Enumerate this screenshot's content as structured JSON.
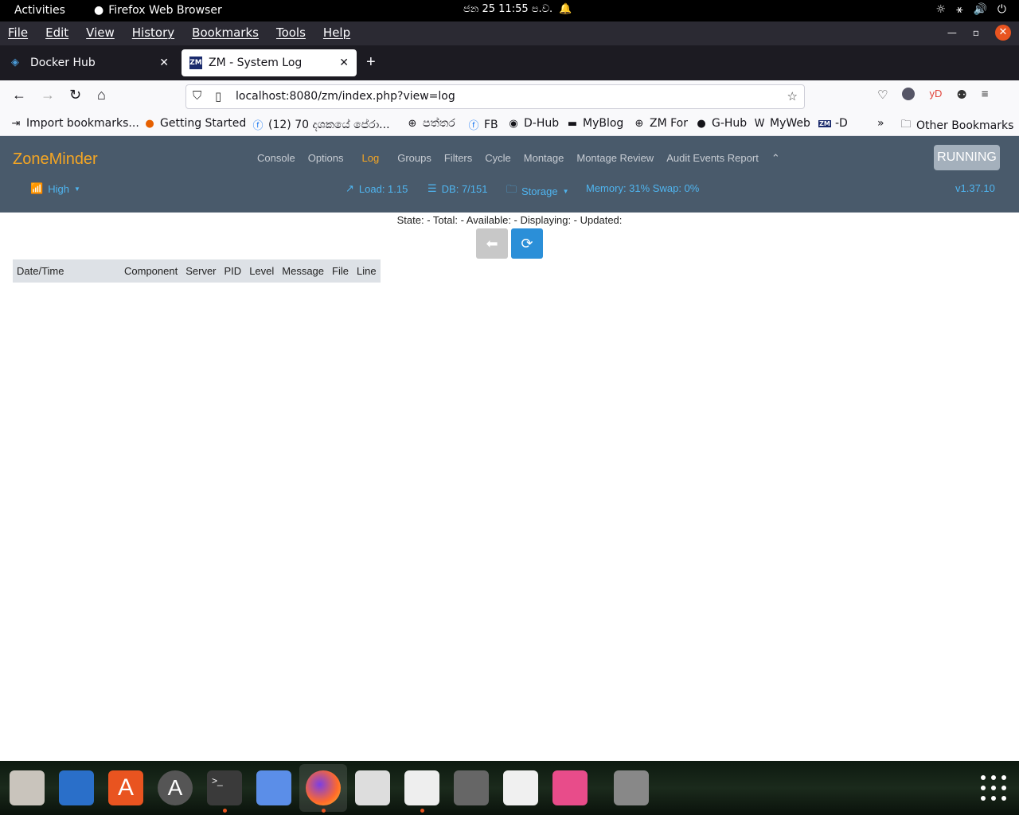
{
  "gnome": {
    "activities": "Activities",
    "app_name": "Firefox Web Browser",
    "clock": "ජන 25  11:55 ප.ව."
  },
  "menubar": {
    "items": [
      "File",
      "Edit",
      "View",
      "History",
      "Bookmarks",
      "Tools",
      "Help"
    ]
  },
  "tabs": [
    {
      "label": "Docker Hub"
    },
    {
      "label": "ZM - System Log"
    }
  ],
  "nav": {
    "url": "localhost:8080/zm/index.php?view=log",
    "extension_label": "yD"
  },
  "bookmarks": [
    {
      "label": "Import bookmarks..."
    },
    {
      "label": "Getting Started"
    },
    {
      "label": "(12) 70 දශකයේ පේරා..."
    },
    {
      "label": "පත්තර"
    },
    {
      "label": "FB"
    },
    {
      "label": "D-Hub"
    },
    {
      "label": "MyBlog"
    },
    {
      "label": "ZM For"
    },
    {
      "label": "G-Hub"
    },
    {
      "label": "MyWeb"
    },
    {
      "label": "-D"
    },
    {
      "label": "Other Bookmarks"
    }
  ],
  "zm": {
    "brand": "ZoneMinder",
    "nav": [
      "Console",
      "Options",
      "Log",
      "Groups",
      "Filters",
      "Cycle",
      "Montage",
      "Montage Review",
      "Audit Events Report"
    ],
    "active": "Log",
    "status": "RUNNING",
    "bandwidth": "High",
    "load": "Load: 1.15",
    "db": "DB: 7/151",
    "storage": "Storage",
    "memory": "Memory: 31% Swap: 0%",
    "version": "v1.37.10"
  },
  "log": {
    "state_line": "State:  -  Total:  -  Available:  -  Displaying:  -  Updated:",
    "columns": [
      "Date/Time",
      "Component",
      "Server",
      "PID",
      "Level",
      "Message",
      "File",
      "Line"
    ]
  },
  "colors": {
    "accent": "#f5a623",
    "header_bg": "#495a6b",
    "link": "#4fb5f0",
    "ubuntu_orange": "#e95420"
  }
}
